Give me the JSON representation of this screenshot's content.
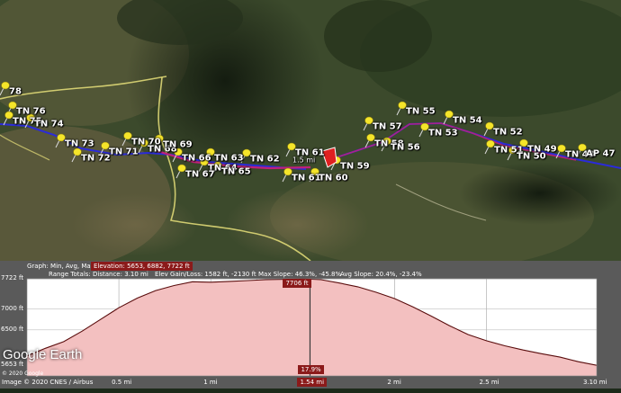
{
  "map": {
    "pins": [
      {
        "label": "78"
      },
      {
        "label": "TN 76"
      },
      {
        "label": "TN 75"
      },
      {
        "label": "TN 74"
      },
      {
        "label": "TN 73"
      },
      {
        "label": "TN 72"
      },
      {
        "label": "TN 71"
      },
      {
        "label": "TN 70"
      },
      {
        "label": "TN 68"
      },
      {
        "label": "TN 69"
      },
      {
        "label": "TN 66"
      },
      {
        "label": "TN 63"
      },
      {
        "label": "TN 64"
      },
      {
        "label": "TN 67"
      },
      {
        "label": "TN 65"
      },
      {
        "label": "TN 62"
      },
      {
        "label": "TN 61"
      },
      {
        "label": "TN 61"
      },
      {
        "label": "TN 60"
      },
      {
        "label": "TN 59"
      },
      {
        "label": "TN 57"
      },
      {
        "label": "TN 58"
      },
      {
        "label": "TN 56"
      },
      {
        "label": "TN 55"
      },
      {
        "label": "TN 54"
      },
      {
        "label": "TN 53"
      },
      {
        "label": "TN 52"
      },
      {
        "label": "TN 51"
      },
      {
        "label": "TN 50"
      },
      {
        "label": "TN 49"
      },
      {
        "label": "TN 48"
      },
      {
        "label": "AP 47"
      }
    ],
    "cursor_label": "1.5 mi",
    "colors": {
      "track": "#2b2bd9",
      "track_selected": "#c0207a",
      "road": "#e8e07a",
      "pin": "#f5e52a",
      "cursor": "#e02020"
    }
  },
  "profile": {
    "graph_label": "Graph: Min, Avg, Max",
    "elevation_label": "Elevation: 5653, 6882, 7722 ft",
    "range_totals_label": "Range Totals:",
    "distance_label": "Distance: 3.10 mi",
    "gain_loss_label": "Elev Gain/Loss: 1582 ft, -2130 ft",
    "max_slope_label": "Max Slope: 46.3%, -45.8%",
    "avg_slope_label": "Avg Slope: 20.4%, -23.4%",
    "cursor_elevation": "7706 ft",
    "cursor_slope": "17.9%",
    "cursor_distance": "1.54 mi"
  },
  "chart_data": {
    "type": "area",
    "xlabel": "",
    "ylabel": "",
    "xlim": [
      0,
      3.1
    ],
    "ylim": [
      5400,
      7722
    ],
    "y_ticks": [
      "7722 ft",
      "7000 ft",
      "6500 ft",
      "5653 ft"
    ],
    "y_tick_values": [
      7722,
      7000,
      6500,
      5653
    ],
    "x_ticks": [
      "0.5 mi",
      "1 mi",
      "1.5 mi",
      "2 mi",
      "2.5 mi",
      "3.10 mi"
    ],
    "x_tick_values": [
      0.5,
      1.0,
      1.5,
      2.0,
      2.5,
      3.1
    ],
    "x": [
      0,
      0.1,
      0.2,
      0.3,
      0.4,
      0.5,
      0.6,
      0.7,
      0.8,
      0.9,
      1.0,
      1.1,
      1.2,
      1.3,
      1.4,
      1.5,
      1.6,
      1.7,
      1.8,
      1.9,
      2.0,
      2.1,
      2.2,
      2.3,
      2.4,
      2.5,
      2.6,
      2.7,
      2.8,
      2.9,
      3.0,
      3.1
    ],
    "y": [
      5880,
      6060,
      6220,
      6470,
      6750,
      7030,
      7260,
      7440,
      7560,
      7650,
      7640,
      7660,
      7680,
      7700,
      7710,
      7722,
      7700,
      7620,
      7530,
      7400,
      7250,
      7050,
      6830,
      6600,
      6390,
      6240,
      6120,
      6020,
      5930,
      5850,
      5740,
      5653
    ],
    "cursor_x": 1.54,
    "colors": {
      "fill": "#f3c0c0",
      "line": "#5a0d0d",
      "plot_bg": "#ffffff",
      "grid": "#b0b0b0",
      "cursor": "#3a3a3a"
    }
  },
  "branding": {
    "logo": "Google Earth",
    "copyright": "© 2020 Google",
    "imagery": "Image © 2020 CNES / Airbus"
  }
}
